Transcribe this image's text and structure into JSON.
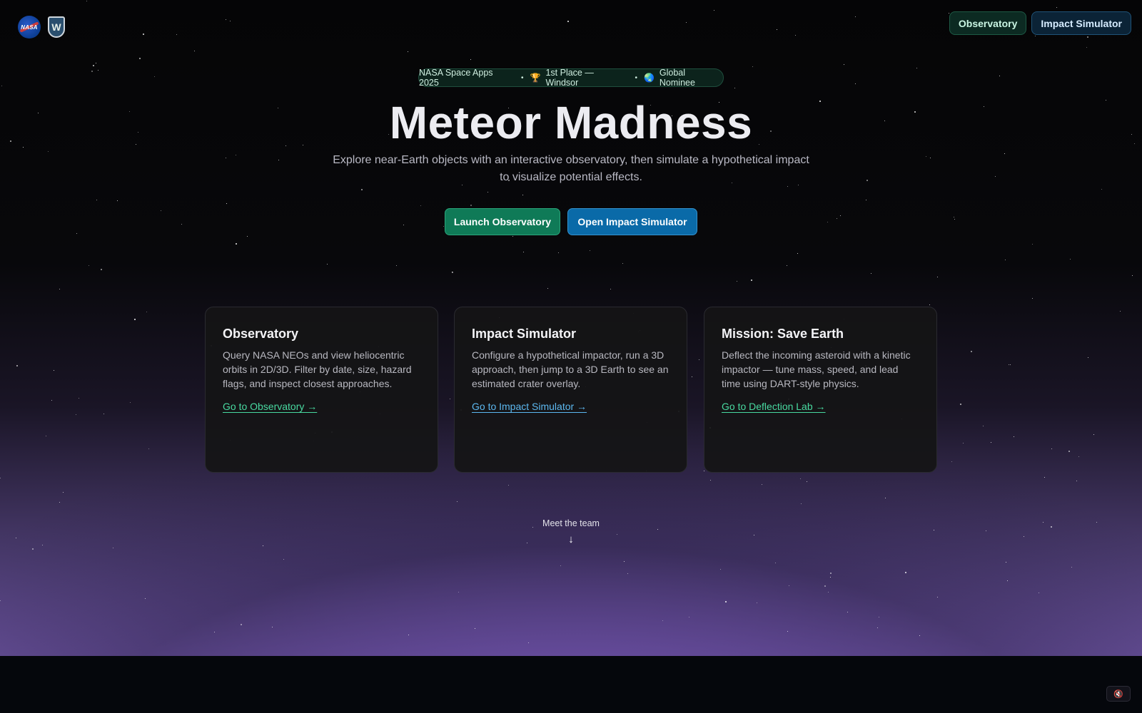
{
  "header": {
    "logos": [
      "nasa-logo",
      "windsor-shield-logo"
    ],
    "nav": [
      {
        "label": "Observatory"
      },
      {
        "label": "Impact Simulator"
      }
    ]
  },
  "badge": {
    "event": "NASA Space Apps 2025",
    "separator": "•",
    "award_icon": "🏆",
    "award": "1st Place — Windsor",
    "globe_icon": "🌏",
    "nominee": "Global Nominee"
  },
  "hero": {
    "title": "Meteor Madness",
    "subtitle": "Explore near-Earth objects with an interactive observatory, then simulate a hypothetical impact to visualize potential effects.",
    "cta_primary": "Launch Observatory",
    "cta_secondary": "Open Impact Simulator"
  },
  "cards": [
    {
      "title": "Observatory",
      "body": "Query NASA NEOs and view heliocentric orbits in 2D/3D. Filter by date, size, hazard flags, and inspect closest approaches.",
      "link": "Go to Observatory →"
    },
    {
      "title": "Impact Simulator",
      "body": "Configure a hypothetical impactor, run a 3D approach, then jump to a 3D Earth to see an estimated crater overlay.",
      "link": "Go to Impact Simulator →"
    },
    {
      "title": "Mission: Save Earth",
      "body": "Deflect the incoming asteroid with a kinetic impactor — tune mass, speed, and lead time using DART-style physics.",
      "link": "Go to Deflection Lab →"
    }
  ],
  "team": {
    "label": "Meet the team",
    "arrow": "↓"
  },
  "sound_toggle": {
    "icon": "🔇",
    "icon_name": "mute-icon"
  },
  "colors": {
    "accent_green": "#0f7a57",
    "accent_blue": "#0a6aa8",
    "link_green": "#48d9a0",
    "link_blue": "#5cb8f0"
  }
}
